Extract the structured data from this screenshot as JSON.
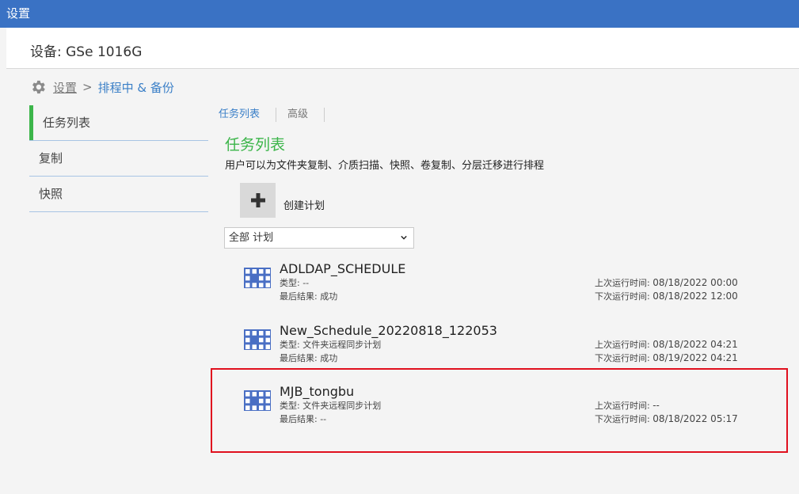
{
  "window": {
    "title": "设置"
  },
  "device": {
    "title": "设备: GSe 1016G"
  },
  "breadcrumb": {
    "root": "设置",
    "separator": ">",
    "current": "排程中 & 备份"
  },
  "sidebar": {
    "items": [
      {
        "label": "任务列表",
        "active": true
      },
      {
        "label": "复制",
        "active": false
      },
      {
        "label": "快照",
        "active": false
      }
    ]
  },
  "tabs": [
    {
      "label": "任务列表",
      "active": true
    },
    {
      "label": "高级",
      "active": false
    }
  ],
  "main": {
    "title": "任务列表",
    "description": "用户可以为文件夹复制、介质扫描、快照、卷复制、分层迁移进行排程",
    "create_label": "创建计划",
    "filter": {
      "selected": "全部 计划"
    }
  },
  "schedules": [
    {
      "name": "ADLDAP_SCHEDULE",
      "type": "类型: --",
      "result": "最后结果: 成功",
      "last_run_label": "上次运行时间: ",
      "last_run": "08/18/2022 00:00",
      "next_run_label": "下次运行时间: ",
      "next_run": "08/18/2022 12:00"
    },
    {
      "name": "New_Schedule_20220818_122053",
      "type": "类型: 文件夹远程同步计划",
      "result": "最后结果: 成功",
      "last_run_label": "上次运行时间: ",
      "last_run": "08/18/2022 04:21",
      "next_run_label": "下次运行时间: ",
      "next_run": "08/19/2022 04:21"
    },
    {
      "name": "MJB_tongbu",
      "type": "类型: 文件夹远程同步计划",
      "result": "最后结果: --",
      "last_run_label": "上次运行时间: ",
      "last_run": "--",
      "next_run_label": "下次运行时间: ",
      "next_run": "08/18/2022 05:17"
    }
  ],
  "colors": {
    "titlebar": "#3a72c4",
    "accent_green": "#3cb54a",
    "link_blue": "#3a7fc7",
    "calendar_icon": "#4a6fc4",
    "highlight": "#e0101e"
  },
  "icons": {
    "breadcrumb": "gear-icon",
    "create": "plus-icon",
    "filter": "chevron-down-icon",
    "schedule": "calendar-grid-icon"
  }
}
